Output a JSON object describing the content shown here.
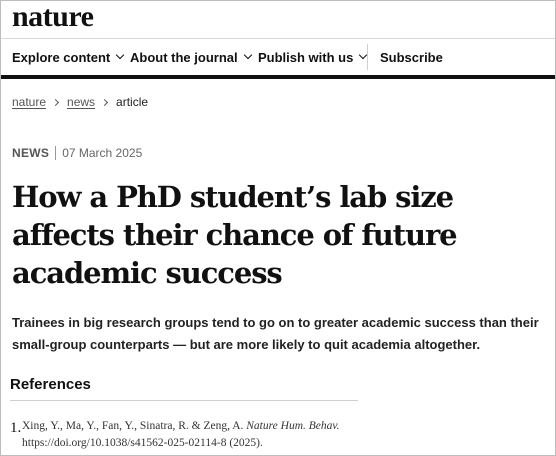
{
  "site": {
    "logo": "nature"
  },
  "nav": {
    "items": [
      {
        "label": "Explore content",
        "has_menu": true
      },
      {
        "label": "About the journal",
        "has_menu": true
      },
      {
        "label": "Publish with us",
        "has_menu": true
      },
      {
        "label": "Subscribe",
        "has_menu": false
      }
    ]
  },
  "breadcrumb": {
    "items": [
      "nature",
      "news"
    ],
    "current": "article"
  },
  "article": {
    "type": "NEWS",
    "date": "07 March 2025",
    "title": "How a PhD student’s lab size affects their chance of future academic success",
    "standfirst": "Trainees in big research groups tend to go on to greater academic success than their small-group counterparts — but are more likely to quit academia altogether."
  },
  "references": {
    "heading": "References",
    "items": [
      {
        "number": "1.",
        "authors": "Xing, Y., Ma, Y., Fan, Y., Sinatra, R. & Zeng, A.",
        "journal": "Nature Hum. Behav.",
        "doi_year": "https://doi.org/10.1038/s41562-025-02114-8 (2025)."
      }
    ]
  },
  "colors": {
    "text": "#111111",
    "rule": "#111111",
    "muted": "#666666"
  }
}
